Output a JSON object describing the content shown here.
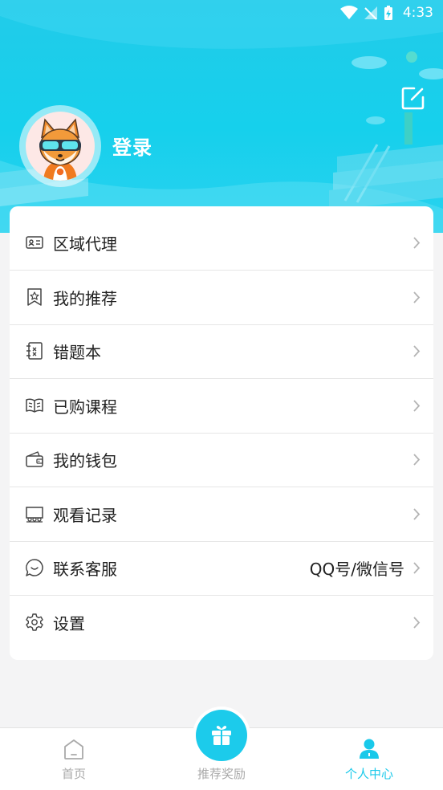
{
  "status_bar": {
    "time": "4:33"
  },
  "profile": {
    "login_label": "登录"
  },
  "menu": [
    {
      "label": "区域代理",
      "icon": "id-card-icon",
      "value": ""
    },
    {
      "label": "我的推荐",
      "icon": "bookmark-star-icon",
      "value": ""
    },
    {
      "label": "错题本",
      "icon": "notebook-x-icon",
      "value": ""
    },
    {
      "label": "已购课程",
      "icon": "open-book-icon",
      "value": ""
    },
    {
      "label": "我的钱包",
      "icon": "wallet-icon",
      "value": ""
    },
    {
      "label": "观看记录",
      "icon": "theater-icon",
      "value": ""
    },
    {
      "label": "联系客服",
      "icon": "chat-bubble-icon",
      "value": "QQ号/微信号"
    },
    {
      "label": "设置",
      "icon": "gear-icon",
      "value": ""
    }
  ],
  "tabbar": {
    "home": "首页",
    "rewards": "推荐奖励",
    "profile": "个人中心"
  },
  "colors": {
    "accent": "#19c9ea",
    "header": "#16d0ec"
  }
}
